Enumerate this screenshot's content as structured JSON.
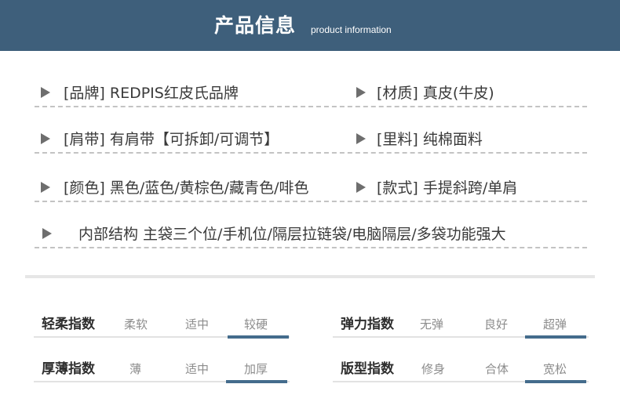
{
  "header": {
    "title": "产品信息",
    "subtitle": "product information"
  },
  "specs": [
    [
      {
        "label": "[品牌] REDPIS红皮氏品牌"
      },
      {
        "label": "[材质] 真皮(牛皮)"
      }
    ],
    [
      {
        "label": "[肩带] 有肩带【可拆卸/可调节】"
      },
      {
        "label": "[里料] 纯棉面料"
      }
    ],
    [
      {
        "label": "[颜色] 黑色/蓝色/黄棕色/藏青色/啡色"
      },
      {
        "label": "[款式] 手提斜跨/单肩"
      }
    ],
    [
      {
        "label": "内部结构 主袋三个位/手机位/隔层拉链袋/电脑隔层/多袋功能强大"
      }
    ]
  ],
  "indices": [
    {
      "label": "轻柔指数",
      "options": [
        "柔软",
        "适中",
        "较硬"
      ],
      "selected": 2
    },
    {
      "label": "弹力指数",
      "options": [
        "无弹",
        "良好",
        "超弹"
      ],
      "selected": 2
    },
    {
      "label": "厚薄指数",
      "options": [
        "薄",
        "适中",
        "加厚"
      ],
      "selected": 2
    },
    {
      "label": "版型指数",
      "options": [
        "修身",
        "合体",
        "宽松"
      ],
      "selected": 2
    }
  ],
  "colors": {
    "header_bg": "#3e5f7b",
    "accent": "#446c8c",
    "arrow": "#6e6e6e"
  }
}
